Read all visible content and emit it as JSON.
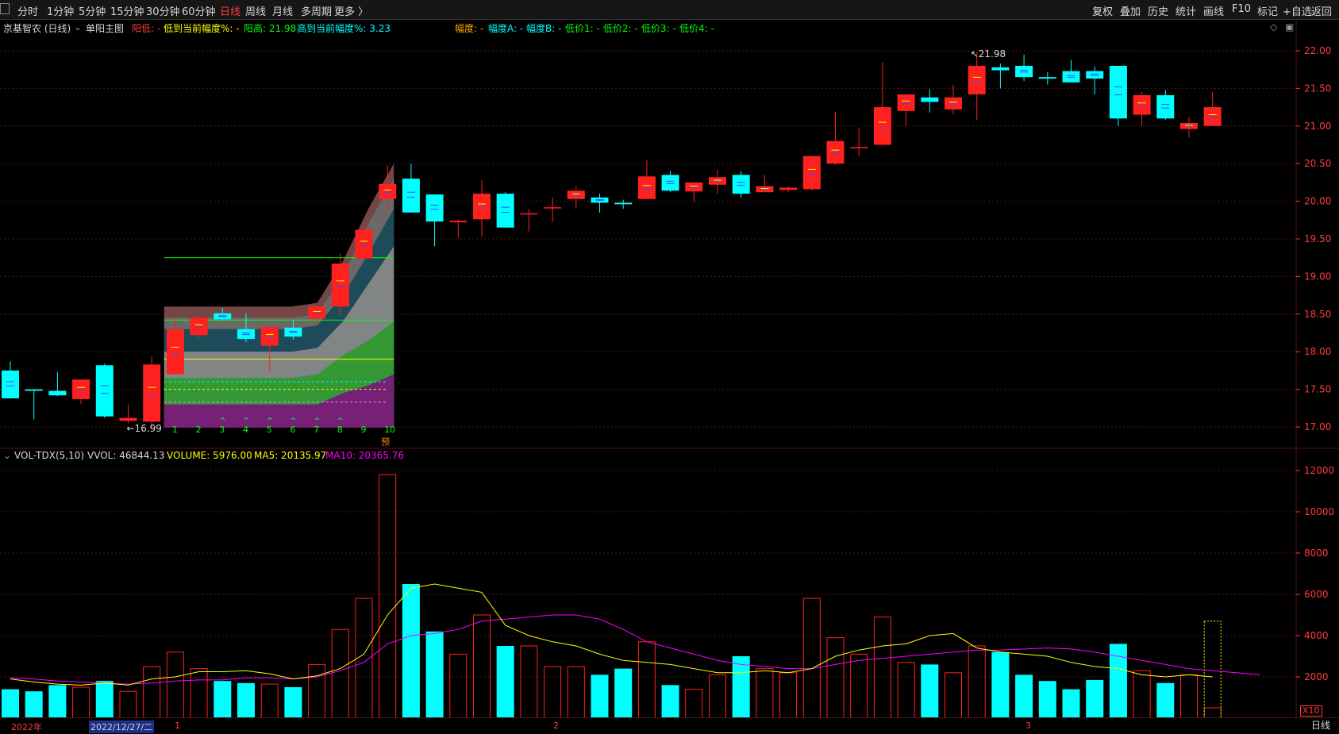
{
  "toolbar": {
    "left": [
      "分时",
      "1分钟",
      "5分钟",
      "15分钟",
      "30分钟",
      "60分钟",
      "日线",
      "周线",
      "月线",
      "多周期",
      "更多 〉"
    ],
    "active_index": 6,
    "right": [
      "复权",
      "叠加",
      "历史",
      "统计",
      "画线",
      "F10",
      "标记",
      "+自选",
      "返回"
    ]
  },
  "stock": {
    "title": "京基智农 (日线)",
    "indicator": "单阳主图"
  },
  "info_line1": {
    "yang_low": "阳低: -",
    "low_to_cur": "低到当前幅度%: -",
    "yang_high": "阳高: 21.98",
    "high_to_cur": "高到当前幅度%: 3.23"
  },
  "info_line2": {
    "fudu": "幅度: -",
    "fudu_a": "幅度A: -",
    "fudu_b": "幅度B: -",
    "low1": "低价1: -",
    "low2": "低价2: -",
    "low3": "低价3: -",
    "low4": "低价4: -"
  },
  "price_axis": {
    "labels": [
      "22.00",
      "21.50",
      "21.00",
      "20.50",
      "20.00",
      "19.50",
      "19.00",
      "18.50",
      "18.00",
      "17.50",
      "17.00"
    ],
    "min": 16.8,
    "max": 22.2
  },
  "price_annotations": {
    "high": "21.98",
    "low": "16.99",
    "yu": "预"
  },
  "counting": [
    "1",
    "2",
    "3",
    "4",
    "5",
    "6",
    "7",
    "8",
    "9",
    "10"
  ],
  "vol_header": {
    "name": "VOL-TDX(5,10)",
    "vvol": "VVOL: 46844.13",
    "volume": "VOLUME: 5976.00",
    "ma5": "MA5: 20135.97",
    "ma10": "MA10: 20365.76"
  },
  "vol_axis": {
    "labels": [
      "12000",
      "10000",
      "8000",
      "6000",
      "4000",
      "2000"
    ],
    "max": 12500
  },
  "x_axis": {
    "year": "2022年",
    "selected_date": "2022/12/27/二",
    "months": [
      "1",
      "2",
      "3"
    ]
  },
  "x10": "X10",
  "period": "日线",
  "colors": {
    "up": "#ff2020",
    "down": "#00ffff",
    "ma5": "#ffff00",
    "ma10": "#ff00ff",
    "grid": "#5a1010",
    "axis": "#ff3b3b"
  },
  "chart_data": {
    "type": "candlestick",
    "ohlc": [
      [
        17.75,
        17.87,
        17.38,
        17.38
      ],
      [
        17.5,
        17.5,
        17.1,
        17.48
      ],
      [
        17.48,
        17.73,
        17.41,
        17.42
      ],
      [
        17.37,
        17.63,
        17.3,
        17.63
      ],
      [
        17.82,
        17.84,
        17.12,
        17.14
      ],
      [
        17.08,
        17.3,
        17.05,
        17.12
      ],
      [
        17.07,
        17.94,
        16.99,
        17.83
      ],
      [
        17.7,
        18.45,
        17.7,
        18.3
      ],
      [
        18.22,
        18.5,
        18.18,
        18.45
      ],
      [
        18.51,
        18.58,
        18.41,
        18.43
      ],
      [
        18.3,
        18.51,
        18.13,
        18.17
      ],
      [
        18.08,
        18.27,
        17.74,
        18.33
      ],
      [
        18.32,
        18.42,
        18.16,
        18.2
      ],
      [
        18.44,
        18.61,
        18.36,
        18.6
      ],
      [
        18.6,
        19.3,
        18.47,
        19.17
      ],
      [
        19.24,
        19.68,
        19.23,
        19.62
      ],
      [
        20.03,
        20.48,
        19.9,
        20.23
      ],
      [
        20.3,
        20.5,
        19.85,
        19.85
      ],
      [
        20.09,
        20.09,
        19.4,
        19.73
      ],
      [
        19.72,
        19.76,
        19.52,
        19.74
      ],
      [
        19.76,
        20.28,
        19.53,
        20.1
      ],
      [
        20.1,
        20.12,
        19.65,
        19.65
      ],
      [
        19.84,
        19.9,
        19.6,
        19.84
      ],
      [
        19.92,
        20.05,
        19.72,
        19.92
      ],
      [
        20.03,
        20.2,
        19.9,
        20.14
      ],
      [
        20.05,
        20.1,
        19.85,
        19.98
      ],
      [
        19.98,
        20.02,
        19.9,
        19.96
      ],
      [
        20.03,
        20.55,
        20.03,
        20.33
      ],
      [
        20.35,
        20.4,
        20.12,
        20.14
      ],
      [
        20.13,
        20.25,
        19.99,
        20.25
      ],
      [
        20.22,
        20.42,
        20.1,
        20.32
      ],
      [
        20.35,
        20.4,
        20.05,
        20.1
      ],
      [
        20.12,
        20.35,
        20.12,
        20.2
      ],
      [
        20.15,
        20.2,
        20.12,
        20.18
      ],
      [
        20.16,
        20.6,
        20.14,
        20.6
      ],
      [
        20.5,
        21.19,
        20.48,
        20.8
      ],
      [
        20.72,
        20.98,
        20.6,
        20.72
      ],
      [
        20.75,
        21.84,
        20.74,
        21.25
      ],
      [
        21.2,
        21.42,
        21.0,
        21.42
      ],
      [
        21.38,
        21.49,
        21.18,
        21.32
      ],
      [
        21.22,
        21.55,
        21.16,
        21.38
      ],
      [
        21.42,
        21.98,
        21.08,
        21.8
      ],
      [
        21.78,
        21.83,
        21.5,
        21.74
      ],
      [
        21.8,
        21.95,
        21.6,
        21.65
      ],
      [
        21.65,
        21.72,
        21.55,
        21.63
      ],
      [
        21.73,
        21.88,
        21.58,
        21.58
      ],
      [
        21.73,
        21.79,
        21.42,
        21.63
      ],
      [
        21.8,
        21.8,
        21.0,
        21.1
      ],
      [
        21.15,
        21.45,
        21.0,
        21.41
      ],
      [
        21.41,
        21.48,
        21.08,
        21.1
      ],
      [
        20.96,
        21.12,
        20.85,
        21.04
      ],
      [
        21.0,
        21.45,
        21.0,
        21.25
      ]
    ],
    "volume": [
      1400,
      1300,
      1600,
      1500,
      1800,
      1300,
      2500,
      3200,
      2400,
      1800,
      1700,
      1650,
      1500,
      2600,
      4300,
      5800,
      11800,
      6500,
      4200,
      3100,
      5000,
      3500,
      3500,
      2500,
      2500,
      2100,
      2400,
      3700,
      1600,
      1400,
      2100,
      3000,
      2400,
      2200,
      5800,
      3900,
      3100,
      4900,
      2700,
      2600,
      2200,
      3500,
      3200,
      2100,
      1800,
      1400,
      1850,
      3600,
      2300,
      1700,
      2100,
      500
    ],
    "partial_volume": 4700,
    "ma5": [
      1900,
      1750,
      1650,
      1600,
      1700,
      1600,
      1900,
      2000,
      2250,
      2250,
      2300,
      2150,
      1900,
      2050,
      2400,
      3100,
      5000,
      6300,
      6500,
      6300,
      6100,
      4500,
      4000,
      3700,
      3500,
      3100,
      2800,
      2700,
      2600,
      2400,
      2200,
      2200,
      2300,
      2200,
      2400,
      3000,
      3300,
      3500,
      3600,
      4000,
      4100,
      3400,
      3200,
      3100,
      3000,
      2700,
      2500,
      2400,
      2100,
      2000,
      2100,
      2000
    ],
    "ma10": [
      1950,
      1900,
      1800,
      1750,
      1700,
      1650,
      1700,
      1800,
      1850,
      1850,
      1950,
      1950,
      1900,
      2000,
      2300,
      2700,
      3600,
      4000,
      4100,
      4300,
      4700,
      4800,
      4900,
      5000,
      5000,
      4800,
      4300,
      3700,
      3400,
      3100,
      2800,
      2600,
      2500,
      2400,
      2400,
      2600,
      2800,
      2900,
      3000,
      3100,
      3200,
      3300,
      3300,
      3350,
      3400,
      3350,
      3200,
      3000,
      2800,
      2600,
      2400,
      2300,
      2200,
      2100
    ]
  }
}
